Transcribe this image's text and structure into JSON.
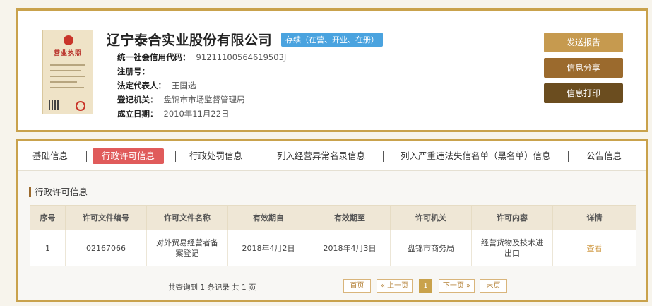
{
  "company": {
    "name": "辽宁泰合实业股份有限公司",
    "status": "存续（在营、开业、在册）",
    "license_title": "营业执照",
    "fields": [
      {
        "key": "统一社会信用代码：",
        "value": "91211100564619503J"
      },
      {
        "key": "注册号：",
        "value": ""
      },
      {
        "key": "法定代表人：",
        "value": "王国选"
      },
      {
        "key": "登记机关：",
        "value": "盘锦市市场监督管理局"
      },
      {
        "key": "成立日期：",
        "value": "2010年11月22日"
      }
    ]
  },
  "actions": {
    "send_report": "发送报告",
    "share": "信息分享",
    "print": "信息打印"
  },
  "tabs": [
    "基础信息",
    "行政许可信息",
    "行政处罚信息",
    "列入经营异常名录信息",
    "列入严重违法失信名单（黑名单）信息",
    "公告信息"
  ],
  "section_title": "行政许可信息",
  "table": {
    "headers": [
      "序号",
      "许可文件编号",
      "许可文件名称",
      "有效期自",
      "有效期至",
      "许可机关",
      "许可内容",
      "详情"
    ],
    "rows": [
      [
        "1",
        "02167066",
        "对外贸易经营者备案登记",
        "2018年4月2日",
        "2018年4月3日",
        "盘锦市商务局",
        "经营货物及技术进出口",
        "查看"
      ]
    ]
  },
  "pager": {
    "info": "共查询到 1 条记录 共 1 页",
    "first": "首页",
    "prev": "« 上一页",
    "current": "1",
    "next": "下一页 »",
    "last": "末页"
  },
  "colors": {
    "accent_gold": "#c9a24c",
    "active_tab": "#e05b5b",
    "status_badge": "#4aa3df"
  }
}
